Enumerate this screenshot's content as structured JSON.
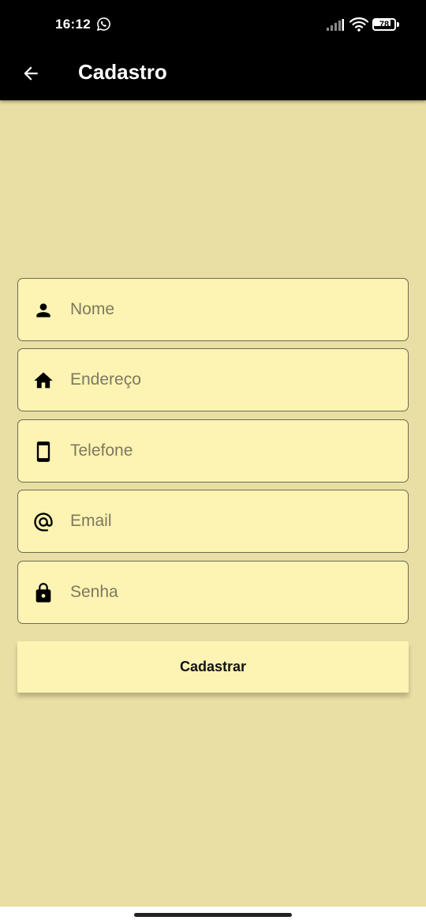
{
  "status_bar": {
    "time": "16:12",
    "battery_level": "78",
    "icons": [
      "whatsapp-icon",
      "signal-icon",
      "wifi-icon",
      "battery-icon"
    ]
  },
  "app_bar": {
    "title": "Cadastro",
    "back_icon": "arrow-back-icon"
  },
  "form": {
    "fields": [
      {
        "icon": "person-icon",
        "placeholder": "Nome",
        "value": ""
      },
      {
        "icon": "home-icon",
        "placeholder": "Endereço",
        "value": ""
      },
      {
        "icon": "smartphone-icon",
        "placeholder": "Telefone",
        "value": ""
      },
      {
        "icon": "at-sign-icon",
        "placeholder": "Email",
        "value": ""
      },
      {
        "icon": "lock-icon",
        "placeholder": "Senha",
        "value": ""
      }
    ],
    "submit_label": "Cadastrar"
  },
  "colors": {
    "background": "#e9dea3",
    "field_background": "#fdf3b2",
    "app_bar": "#000000",
    "field_border": "#6e6a55"
  }
}
